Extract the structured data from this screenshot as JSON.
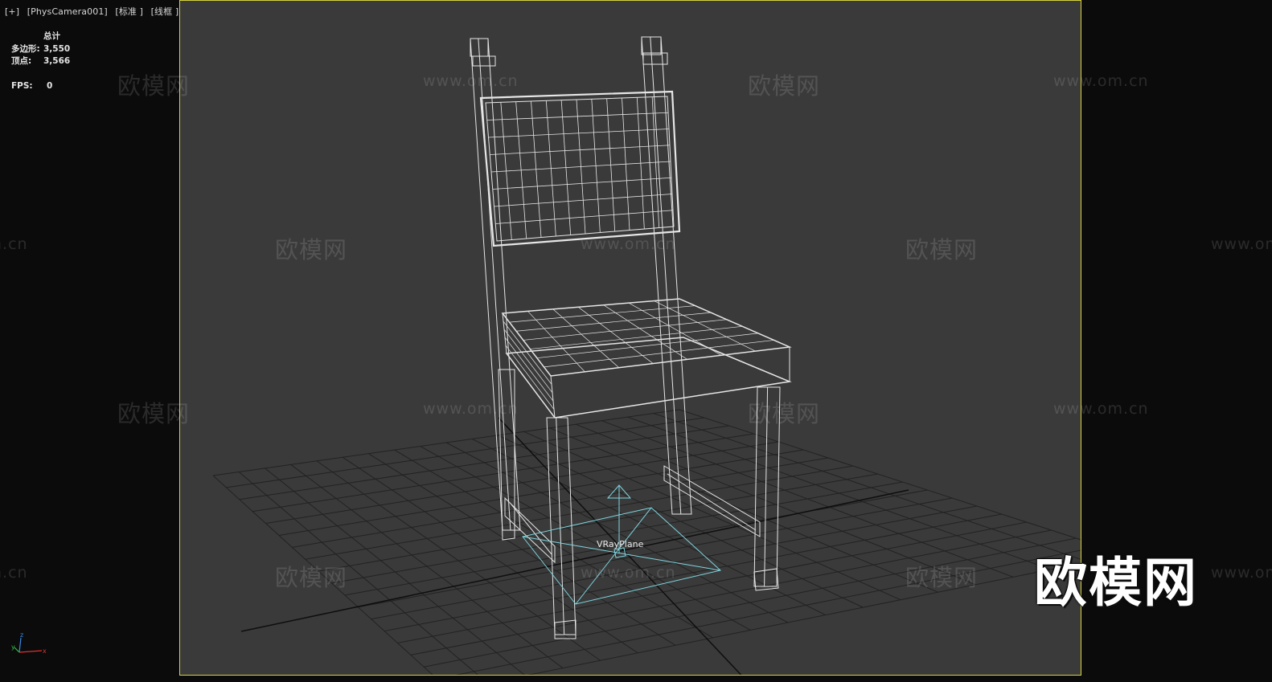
{
  "viewport": {
    "label_parts": [
      "[+]",
      "[PhysCamera001]",
      "[标准 ]",
      "[线框 ]"
    ]
  },
  "stats": {
    "header": "总计",
    "polygons_label": "多边形:",
    "polygons_value": "3,550",
    "vertices_label": "顶点:",
    "vertices_value": "3,566",
    "fps_label": "FPS:",
    "fps_value": "0"
  },
  "scene": {
    "object_label": "VRayPlane",
    "wire_color": "#e6e6e6",
    "plane_color": "#7fd6e0",
    "frame_color": "#d8d23a"
  },
  "watermarks": {
    "text_cn": "欧模网",
    "text_url": "www.om.cn",
    "big_logo": "欧模网"
  },
  "axis": {
    "x": "x",
    "y": "y",
    "z": "z"
  }
}
